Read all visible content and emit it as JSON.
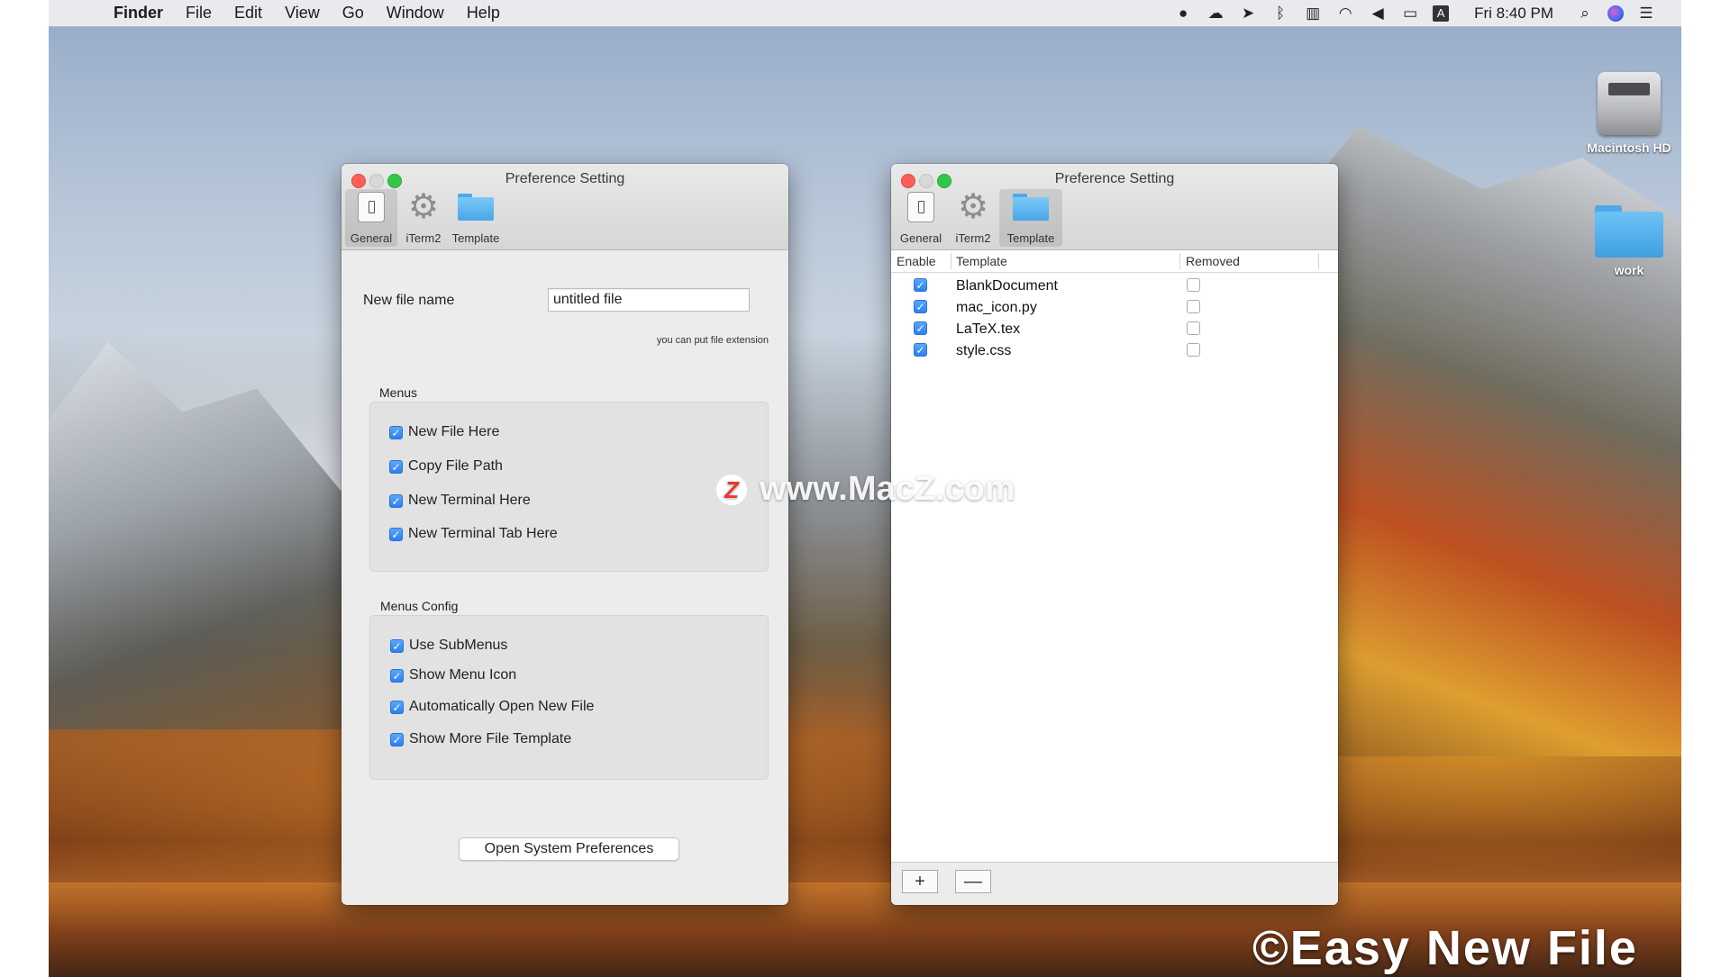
{
  "menubar": {
    "apple": "",
    "items": [
      "Finder",
      "File",
      "Edit",
      "View",
      "Go",
      "Window",
      "Help"
    ],
    "status_input": "A",
    "clock": "Fri 8:40 PM",
    "icons": [
      "wechat-icon",
      "cloud-icon",
      "send-icon",
      "bluetooth-icon",
      "battery-case-icon",
      "wifi-icon",
      "volume-icon",
      "battery-icon",
      "input-source-icon",
      "clock",
      "spotlight-icon",
      "siri-icon",
      "notification-icon"
    ]
  },
  "desktop": {
    "icons": [
      {
        "label": "Macintosh HD",
        "icon": "hard-drive-icon"
      },
      {
        "label": "work",
        "icon": "folder-icon"
      }
    ]
  },
  "window_general": {
    "title": "Preference Setting",
    "toolbar": [
      {
        "label": "General",
        "icon": "switch-icon",
        "active": true
      },
      {
        "label": "iTerm2",
        "icon": "gear-icon",
        "active": false
      },
      {
        "label": "Template",
        "icon": "folder-icon",
        "active": false
      }
    ],
    "new_file_name_label": "New file name",
    "new_file_name_value": "untitled file",
    "hint": "you can put file extension",
    "menus_title": "Menus",
    "menus": [
      {
        "label": "New File Here",
        "checked": true
      },
      {
        "label": "Copy File Path",
        "checked": true
      },
      {
        "label": "New Terminal Here",
        "checked": true
      },
      {
        "label": "New Terminal Tab Here",
        "checked": true
      }
    ],
    "menus_config_title": "Menus Config",
    "menus_config": [
      {
        "label": "Use SubMenus",
        "checked": true
      },
      {
        "label": "Show Menu Icon",
        "checked": true
      },
      {
        "label": "Automatically Open New File",
        "checked": true
      },
      {
        "label": "Show More File Template",
        "checked": true
      }
    ],
    "open_prefs_button": "Open System Preferences"
  },
  "window_template": {
    "title": "Preference Setting",
    "toolbar": [
      {
        "label": "General",
        "icon": "switch-icon",
        "active": false
      },
      {
        "label": "iTerm2",
        "icon": "gear-icon",
        "active": false
      },
      {
        "label": "Template",
        "icon": "folder-icon",
        "active": true
      }
    ],
    "columns": [
      "Enable",
      "Template",
      "Removed"
    ],
    "rows": [
      {
        "enabled": true,
        "name": "BlankDocument",
        "removed": false
      },
      {
        "enabled": true,
        "name": "mac_icon.py",
        "removed": false
      },
      {
        "enabled": true,
        "name": "LaTeX.tex",
        "removed": false
      },
      {
        "enabled": true,
        "name": "style.css",
        "removed": false
      }
    ],
    "add_button": "+",
    "remove_button": "—"
  },
  "watermark": {
    "logo": "Z",
    "text": "www.MacZ.com"
  },
  "brand": "©Easy New File",
  "colors": {
    "checkbox_blue": "#2d7ff0",
    "close_red": "#fc5f57",
    "zoom_green": "#33c748"
  }
}
